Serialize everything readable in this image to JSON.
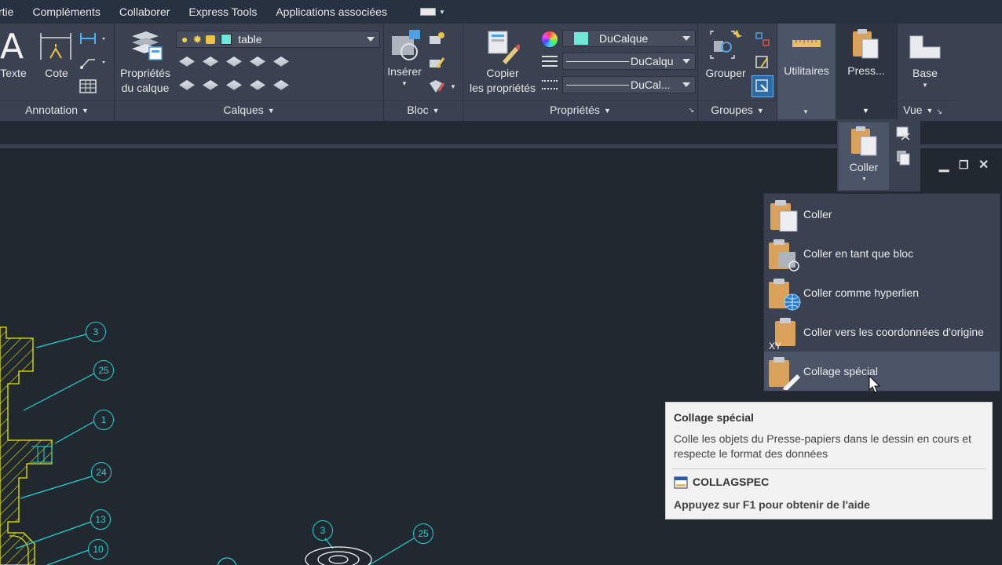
{
  "menubar": {
    "items": [
      "rtie",
      "Compléments",
      "Collaborer",
      "Express Tools",
      "Applications associées"
    ]
  },
  "ribbon": {
    "annotation": {
      "texte": "Texte",
      "cote": "Cote",
      "title": "Annotation"
    },
    "calques": {
      "props_line1": "Propriétés",
      "props_line2": "du calque",
      "layer_value": "table",
      "title": "Calques"
    },
    "bloc": {
      "inserer": "Insérer",
      "title": "Bloc"
    },
    "proprietes": {
      "copy_line1": "Copier",
      "copy_line2": "les propriétés",
      "color_value": "DuCalque",
      "linetype_value": "DuCalqu",
      "lineweight_value": "DuCal...",
      "title": "Propriétés"
    },
    "groupes": {
      "grouper": "Grouper",
      "title": "Groupes"
    },
    "utilitaires": {
      "label": "Utilitaires"
    },
    "presse": {
      "label": "Press..."
    },
    "vue": {
      "base": "Base",
      "title": "Vue"
    }
  },
  "dropdown": {
    "coller_button": "Coller",
    "items": [
      {
        "label": "Coller"
      },
      {
        "label": "Coller en tant que bloc"
      },
      {
        "label": "Coller comme hyperlien"
      },
      {
        "label": "Coller vers les coordonnées d'origine"
      },
      {
        "label": "Collage spécial"
      }
    ]
  },
  "tooltip": {
    "title": "Collage spécial",
    "description": "Colle les objets du Presse-papiers dans le dessin en cours et respecte le format des données",
    "command": "COLLAGSPEC",
    "help": "Appuyez sur F1 pour obtenir de l'aide"
  },
  "drawing": {
    "balloons": [
      "3",
      "25",
      "1",
      "24",
      "13",
      "10",
      "3",
      "25"
    ]
  },
  "colors": {
    "accent_cyan": "#21d4d4",
    "hatch_yellow": "#e8e800",
    "clipboard_tan": "#d9a15a"
  }
}
